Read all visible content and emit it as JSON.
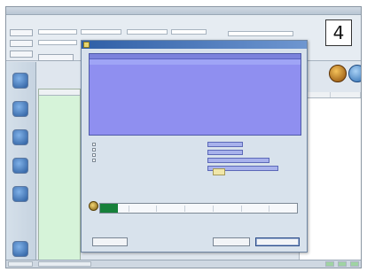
{
  "badge": {
    "value": "4"
  },
  "colors": {
    "dialog_grid": "#8f8ff0",
    "progress_fill": "#16803a",
    "list_pane": "#d6f3d9",
    "title_bar": "#2f5fa6"
  },
  "progress": {
    "fraction": 0.09
  }
}
